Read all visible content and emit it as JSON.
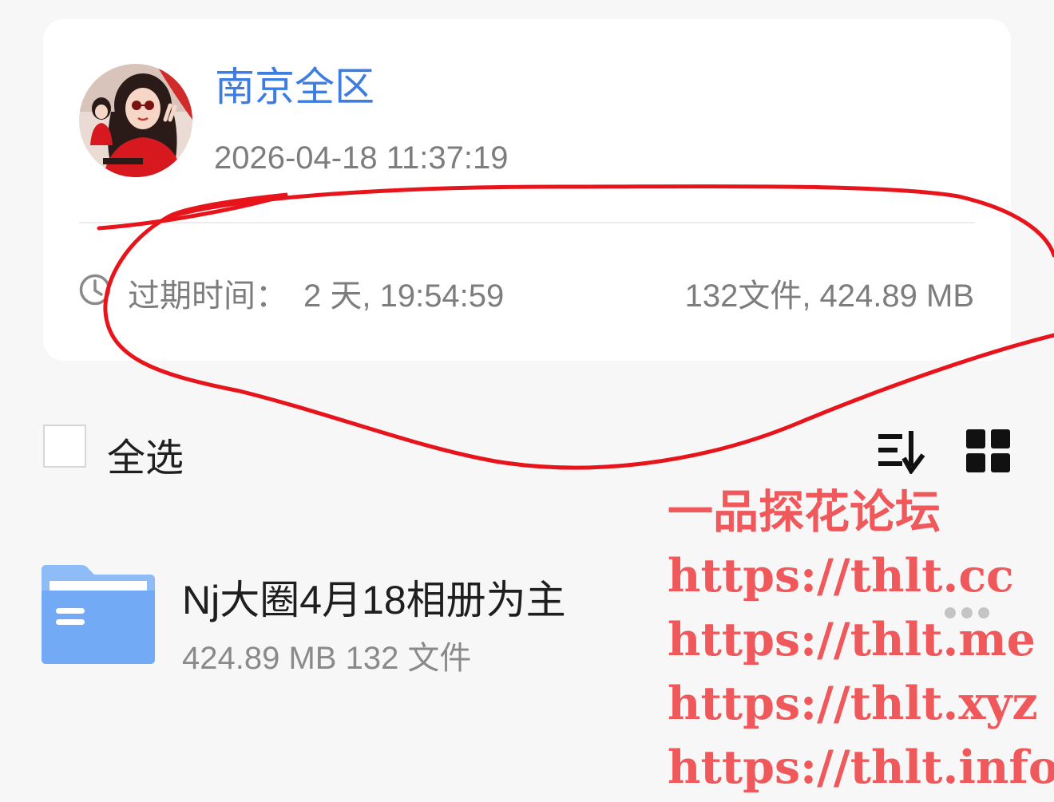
{
  "share": {
    "name": "南京全区",
    "time": "2026-04-18 11:37:19",
    "expire_label": "过期时间：",
    "expire_value": "2 天, 19:54:59",
    "summary": "132文件, 424.89 MB"
  },
  "toolbar": {
    "select_all_label": "全选",
    "sort_icon": "sort-descending-icon",
    "view_icon": "grid-view-icon"
  },
  "files": [
    {
      "name": "Nj大圈4月18相册为主",
      "meta": "424.89 MB 132 文件",
      "icon": "folder-icon"
    }
  ],
  "watermark": {
    "lines": [
      "一品探花论坛",
      "https://thlt.cc",
      "https://thlt.me",
      "https://thlt.xyz",
      "https://thlt.info"
    ]
  },
  "colors": {
    "accent": "#3d7de0",
    "folder": "#72aaf5",
    "watermark": "#f0595b",
    "scribble": "#e8141b"
  }
}
